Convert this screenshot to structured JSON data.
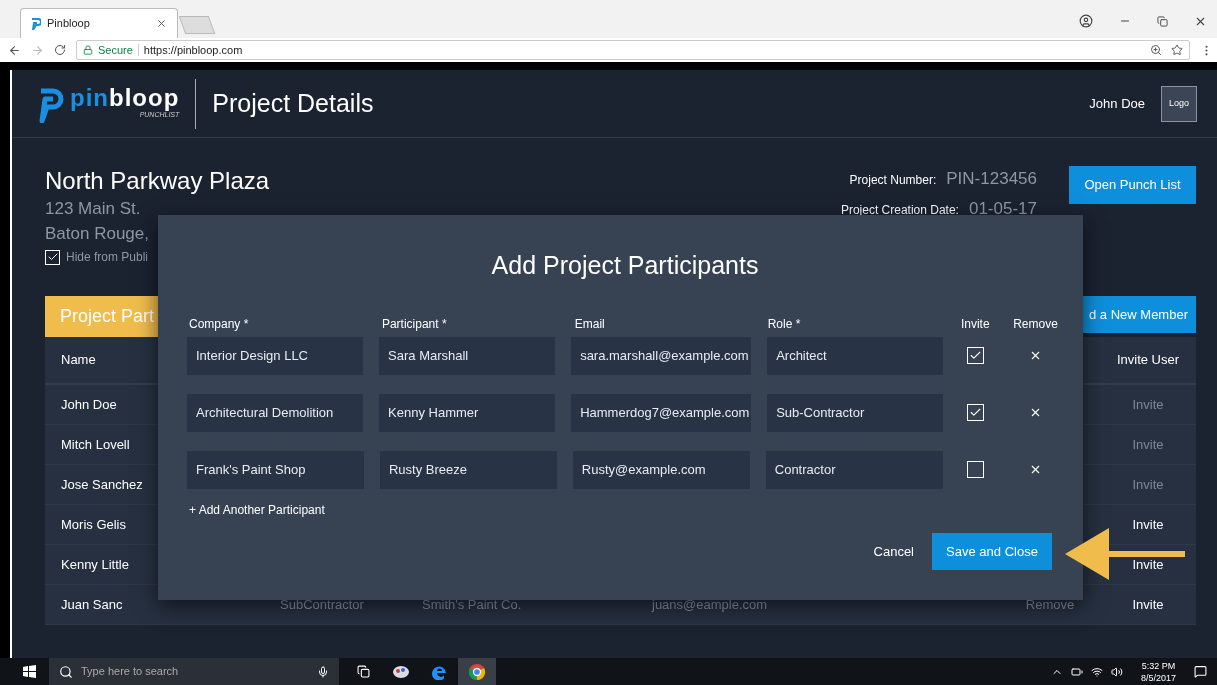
{
  "browser": {
    "tab_title": "Pinbloop",
    "secure_label": "Secure",
    "url": "https://pinbloop.com"
  },
  "header": {
    "brand_a": "pin",
    "brand_b": "bloop",
    "brand_sub": "PUNCHLIST",
    "page_title": "Project Details",
    "user": "John Doe",
    "logo_label": "Logo"
  },
  "project": {
    "name": "North Parkway Plaza",
    "address_line_1": "123 Main St.",
    "address_line_2": "Baton Rouge,",
    "hide_from_public": {
      "label": "Hide from Publi",
      "checked": true
    },
    "meta": [
      {
        "label": "Project Number:",
        "value": "PIN-123456"
      },
      {
        "label": "Project Creation Date:",
        "value": "01-05-17"
      }
    ],
    "open_punch_list": "Open Punch List"
  },
  "participants_panel": {
    "tab_label": "Project Part",
    "add_member_button": "d a New Member",
    "name_column": "Name",
    "invite_column": "Invite User",
    "rows": [
      {
        "name": "John Doe",
        "invite": "Invite",
        "invite_disabled": true
      },
      {
        "name": "Mitch Lovell",
        "invite": "Invite",
        "invite_disabled": true
      },
      {
        "name": "Jose Sanchez",
        "invite": "Invite",
        "invite_disabled": true
      },
      {
        "name": "Moris Gelis",
        "invite": "Invite",
        "invite_disabled": false
      },
      {
        "name": "Kenny Little",
        "invite": "Invite",
        "invite_disabled": false
      },
      {
        "name": "Juan Sanc",
        "invite": "Invite",
        "invite_disabled": false,
        "role": "SubContractor",
        "company": "Smith's Paint Co.",
        "email": "juans@eample.com",
        "remove": "Remove"
      }
    ]
  },
  "modal": {
    "title": "Add Project Participants",
    "columns": [
      "Company *",
      "Participant *",
      "Email",
      "Role *",
      "Invite",
      "Remove"
    ],
    "rows": [
      {
        "company": "Interior Design LLC",
        "participant": "Sara Marshall",
        "email": "sara.marshall@example.com",
        "role": "Architect",
        "invite": true
      },
      {
        "company": "Architectural Demolition",
        "participant": "Kenny Hammer",
        "email": "Hammerdog7@example.com",
        "role": "Sub-Contractor",
        "invite": true
      },
      {
        "company": "Frank's Paint Shop",
        "participant": "Rusty Breeze",
        "email": "Rusty@example.com",
        "role": "Contractor",
        "invite": false
      }
    ],
    "add_link": "+ Add Another Participant",
    "cancel": "Cancel",
    "save": "Save and Close"
  },
  "taskbar": {
    "search_placeholder": "Type here to search",
    "time": "5:32 PM",
    "date": "8/5/2017"
  }
}
